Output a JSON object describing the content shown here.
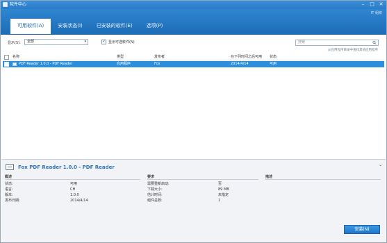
{
  "window": {
    "title": "软件中心",
    "org": "IT 组织",
    "controls": [
      "–",
      "□",
      "✕"
    ]
  },
  "tabs": [
    {
      "label": "可用软件(A)",
      "active": true
    },
    {
      "label": "安装状态(I)",
      "active": false
    },
    {
      "label": "已安装的软件(E)",
      "active": false
    },
    {
      "label": "选项(P)",
      "active": false
    }
  ],
  "filter": {
    "show_label": "显示(S):",
    "show_value": "全部",
    "optional_checkbox_label": "显示可选软件(N)",
    "optional_checked": true,
    "search_placeholder": "搜索",
    "search_hint": "从应用程序目录中查找其他应用程序"
  },
  "table": {
    "headers": {
      "name": "名称",
      "type": "类型",
      "publisher": "发布者",
      "available_after": "在下列时间之后可用",
      "status": "状态"
    },
    "rows": [
      {
        "name": "PDF Reader 1.0.0 - PDF Reader",
        "type": "应用程序",
        "publisher": "Fox",
        "available_after": "2014/4/14",
        "status": "可用"
      }
    ]
  },
  "details": {
    "title": "Fox PDF Reader 1.0.0 - PDF Reader",
    "overview_heading": "概述",
    "requirements_heading": "要求",
    "description_heading": "描述",
    "overview": [
      {
        "label": "状态:",
        "value": "可用"
      },
      {
        "label": "语言:",
        "value": "CH"
      },
      {
        "label": "版本:",
        "value": "1.0.0"
      },
      {
        "label": "发布日期:",
        "value": "2014/4/14"
      }
    ],
    "requirements": [
      {
        "label": "需要重新启动:",
        "value": "否"
      },
      {
        "label": "下载大小:",
        "value": "89 MB"
      },
      {
        "label": "估计时间:",
        "value": "未指定"
      },
      {
        "label": "组件总数:",
        "value": "1"
      }
    ]
  },
  "install_button": "安装(N)"
}
